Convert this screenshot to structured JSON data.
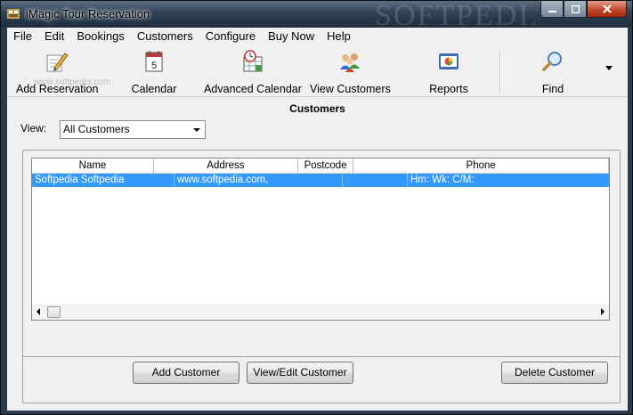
{
  "window": {
    "title": "iMagic Tour Reservation",
    "watermark": "SOFTPEDIA"
  },
  "menu": [
    "File",
    "Edit",
    "Bookings",
    "Customers",
    "Configure",
    "Buy Now",
    "Help"
  ],
  "toolbar": {
    "add_reservation": "Add Reservation",
    "calendar": "Calendar",
    "advanced_calendar": "Advanced Calendar",
    "view_customers": "View Customers",
    "reports": "Reports",
    "find": "Find",
    "watermark": "www.softpedia.com"
  },
  "section_title": "Customers",
  "view": {
    "label": "View:",
    "selected": "All Customers"
  },
  "table": {
    "columns": [
      "Name",
      "Address",
      "Postcode",
      "Phone"
    ],
    "rows": [
      {
        "name": "Softpedia  Softpedia",
        "address": "www.softpedia.com,",
        "postcode": "",
        "phone": "Hm:  Wk:  C/M:"
      }
    ]
  },
  "buttons": {
    "add_customer": "Add Customer",
    "view_edit_customer": "View/Edit Customer",
    "delete_customer": "Delete Customer"
  },
  "colors": {
    "selection": "#3399ff",
    "titlebar": "#2f4254",
    "close_button": "#c24a2d"
  }
}
